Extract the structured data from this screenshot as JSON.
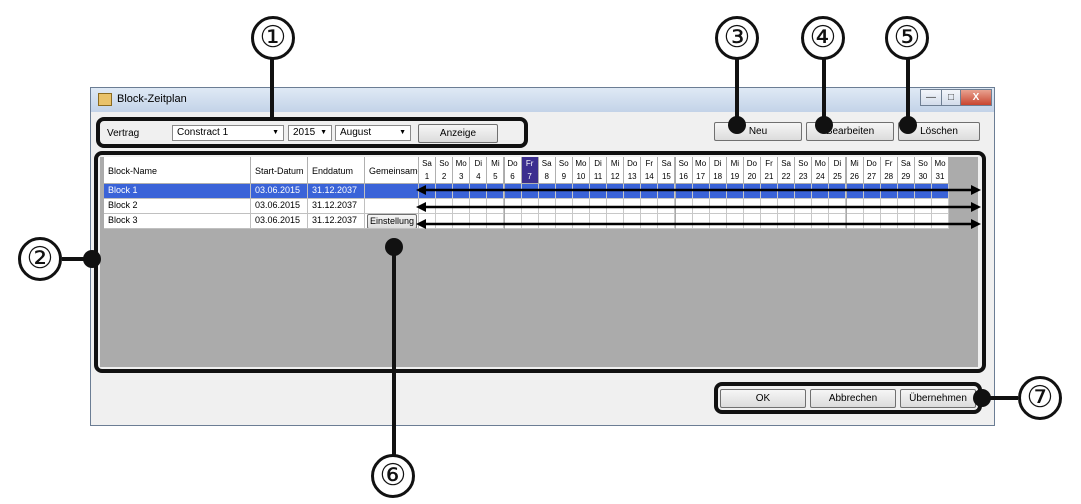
{
  "window": {
    "title": "Block-Zeitplan",
    "min_label": "—",
    "max_label": "□",
    "close_label": "X"
  },
  "toolbar": {
    "contract_label": "Vertrag",
    "contract_value": "Constract 1",
    "year_value": "2015",
    "month_value": "August",
    "show_button": "Anzeige",
    "new_button": "Neu",
    "edit_button": "Bearbeiten",
    "delete_button": "Löschen"
  },
  "table": {
    "columns": [
      "Block-Name",
      "Start-Datum",
      "Enddatum",
      "Gemeinsame"
    ],
    "rows": [
      {
        "name": "Block 1",
        "start": "03.06.2015",
        "end": "31.12.2037",
        "shared": ""
      },
      {
        "name": "Block 2",
        "start": "03.06.2015",
        "end": "31.12.2037",
        "shared": ""
      },
      {
        "name": "Block 3",
        "start": "03.06.2015",
        "end": "31.12.2037",
        "shared": "Einstellung"
      }
    ],
    "weekdays": [
      "Sa",
      "So",
      "Mo",
      "Di",
      "Mi",
      "Do",
      "Fr",
      "Sa",
      "So",
      "Mo",
      "Di",
      "Mi",
      "Do",
      "Fr",
      "Sa",
      "So",
      "Mo",
      "Di",
      "Mi",
      "Do",
      "Fr",
      "Sa",
      "So",
      "Mo",
      "Di",
      "Mi",
      "Do",
      "Fr",
      "Sa",
      "So",
      "Mo"
    ],
    "days": [
      "1",
      "2",
      "3",
      "4",
      "5",
      "6",
      "7",
      "8",
      "9",
      "10",
      "11",
      "12",
      "13",
      "14",
      "15",
      "16",
      "17",
      "18",
      "19",
      "20",
      "21",
      "22",
      "23",
      "24",
      "25",
      "26",
      "27",
      "28",
      "29",
      "30",
      "31"
    ],
    "highlighted_day": "7"
  },
  "footer": {
    "ok_button": "OK",
    "cancel_button": "Abbrechen",
    "apply_button": "Übernehmen"
  },
  "callouts": [
    "①",
    "②",
    "③",
    "④",
    "⑤",
    "⑥",
    "⑦"
  ],
  "colors": {
    "selection": "#3a63d8",
    "today_header": "#3c2f8f",
    "grid_background": "#ababab"
  }
}
